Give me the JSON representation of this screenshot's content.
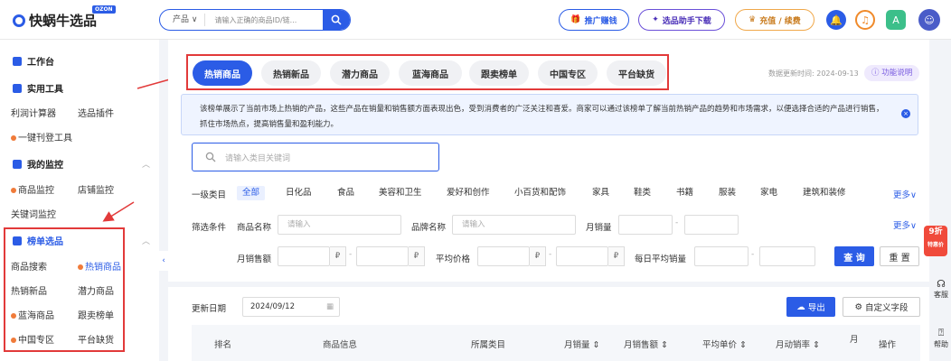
{
  "header": {
    "logo_text": "快蜗牛选品",
    "logo_badge": "OZON",
    "search_type": "产品",
    "search_placeholder": "请输入正确的商品ID/链...",
    "promo_earn": "推广赚钱",
    "download_assistant": "选品助手下载",
    "recharge": "充值 / 续费"
  },
  "sidebar": {
    "workbench": "工作台",
    "tools_title": "实用工具",
    "tools": [
      "利润计算器",
      "选品插件",
      "一键刊登工具"
    ],
    "monitor_title": "我的监控",
    "monitor_items": [
      "商品监控",
      "店铺监控",
      "关键词监控"
    ],
    "ranking_title": "榜单选品",
    "ranking_items": [
      "商品搜索",
      "热销商品",
      "热销新品",
      "潜力商品",
      "蓝海商品",
      "跟卖榜单",
      "中国专区",
      "平台缺货"
    ]
  },
  "tabs": [
    "热销商品",
    "热销新品",
    "潜力商品",
    "蓝海商品",
    "跟卖榜单",
    "中国专区",
    "平台缺货"
  ],
  "update": {
    "label": "数据更新时间: 2024-09-13",
    "help": "功能说明"
  },
  "notice": "该榜单展示了当前市场上热销的产品，这些产品在销量和销售额方面表现出色，受到消费者的广泛关注和喜爱。商家可以通过该榜单了解当前热销产品的趋势和市场需求，以便选择合适的产品进行销售，抓住市场热点，提高销售量和盈利能力。",
  "keyword_placeholder": "请输入类目关键词",
  "filters": {
    "category_label": "一级类目",
    "categories": [
      "全部",
      "日化品",
      "食品",
      "美容和卫生",
      "爱好和创作",
      "小百货和配饰",
      "家具",
      "鞋类",
      "书籍",
      "服装",
      "家电",
      "建筑和装修"
    ],
    "more": "更多",
    "condition_label": "筛选条件",
    "product_name": "商品名称",
    "brand_name": "品牌名称",
    "monthly_sales": "月销量",
    "placeholder": "请输入",
    "monthly_revenue": "月销售额",
    "avg_price": "平均价格",
    "daily_avg_sales": "每日平均销量",
    "currency": "₽",
    "search_btn": "查 询",
    "reset_btn": "重 置"
  },
  "table": {
    "update_date_label": "更新日期",
    "update_date": "2024/09/12",
    "export": "导出",
    "custom_fields": "自定义字段",
    "headers": [
      "排名",
      "商品信息",
      "所属类目",
      "月销量",
      "月销售额",
      "平均单价",
      "月动销率",
      "月",
      "操作"
    ]
  },
  "rail": {
    "promo": "9折",
    "promo_sub": "特惠价",
    "service": "客服",
    "help": "帮助"
  }
}
